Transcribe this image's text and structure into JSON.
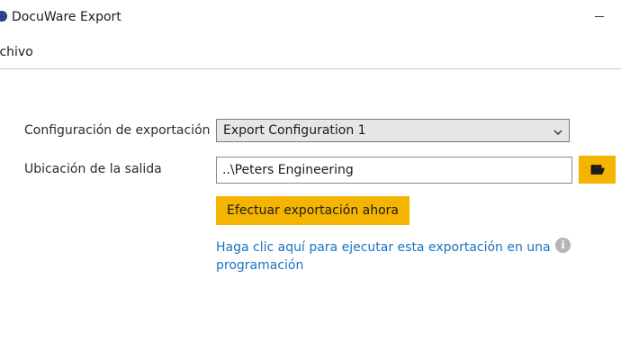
{
  "window": {
    "title": "DocuWare Export",
    "minimize_glyph": "—"
  },
  "menu": {
    "items": [
      {
        "label": "rchivo"
      }
    ]
  },
  "form": {
    "config_label": "Configuración de exportación",
    "config_selected": "Export Configuration 1",
    "output_label": "Ubicación de la salida",
    "output_value": "..\\Peters Engineering",
    "export_button_label": "Efectuar exportación ahora",
    "schedule_link": "Haga clic aquí para ejecutar esta exportación en una programación",
    "info_icon_glyph": "i"
  },
  "icons": {
    "app": "docuware-logo-icon",
    "dropdown": "chevron-down-icon",
    "folder": "folder-open-icon",
    "info": "info-icon"
  },
  "colors": {
    "accent": "#f5b400",
    "link": "#1a73c2",
    "brand": "#2f3b8f",
    "info_icon": "#b5b5b5"
  }
}
